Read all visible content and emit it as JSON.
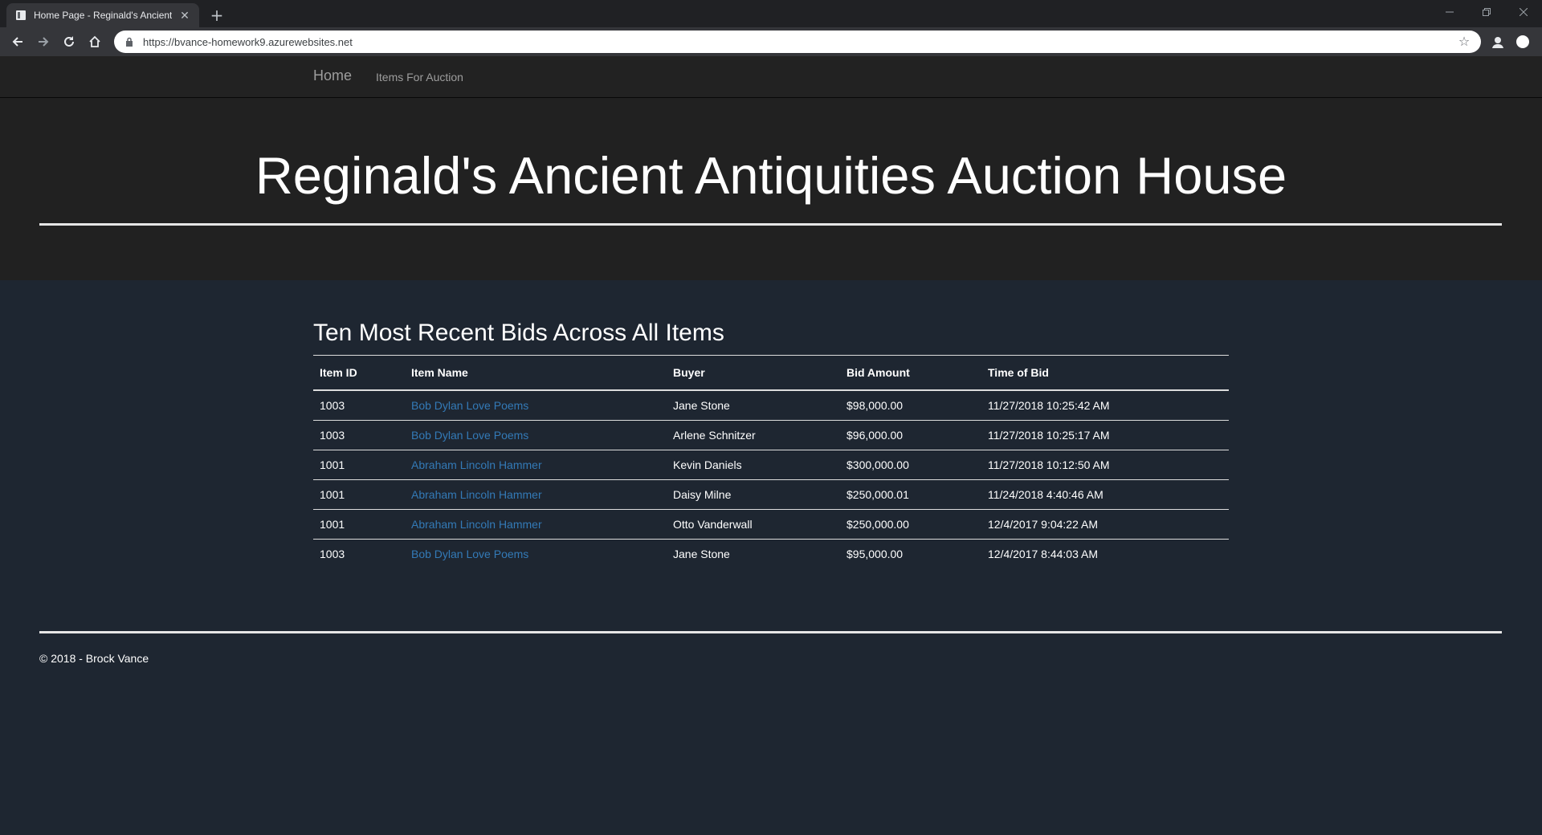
{
  "browser": {
    "tab_title": "Home Page - Reginald's Ancient",
    "url": "https://bvance-homework9.azurewebsites.net",
    "icons": {
      "back": "back-arrow-icon",
      "forward": "forward-arrow-icon",
      "reload": "reload-icon",
      "home": "home-icon",
      "lock": "lock-icon",
      "bookmark": "star-icon",
      "minimize": "minimize-icon",
      "restore": "restore-icon",
      "close": "close-icon"
    }
  },
  "navbar": {
    "brand": "Home",
    "links": [
      "Items For Auction"
    ]
  },
  "hero": {
    "title": "Reginald's Ancient Antiquities Auction House"
  },
  "main": {
    "heading": "Ten Most Recent Bids Across All Items",
    "columns": [
      "Item ID",
      "Item Name",
      "Buyer",
      "Bid Amount",
      "Time of Bid"
    ],
    "rows": [
      {
        "item_id": "1003",
        "item_name": "Bob Dylan Love Poems",
        "buyer": "Jane Stone",
        "bid_amount": "$98,000.00",
        "time": "11/27/2018 10:25:42 AM"
      },
      {
        "item_id": "1003",
        "item_name": "Bob Dylan Love Poems",
        "buyer": "Arlene Schnitzer",
        "bid_amount": "$96,000.00",
        "time": "11/27/2018 10:25:17 AM"
      },
      {
        "item_id": "1001",
        "item_name": "Abraham Lincoln Hammer",
        "buyer": "Kevin Daniels",
        "bid_amount": "$300,000.00",
        "time": "11/27/2018 10:12:50 AM"
      },
      {
        "item_id": "1001",
        "item_name": "Abraham Lincoln Hammer",
        "buyer": "Daisy Milne",
        "bid_amount": "$250,000.01",
        "time": "11/24/2018 4:40:46 AM"
      },
      {
        "item_id": "1001",
        "item_name": "Abraham Lincoln Hammer",
        "buyer": "Otto Vanderwall",
        "bid_amount": "$250,000.00",
        "time": "12/4/2017 9:04:22 AM"
      },
      {
        "item_id": "1003",
        "item_name": "Bob Dylan Love Poems",
        "buyer": "Jane Stone",
        "bid_amount": "$95,000.00",
        "time": "12/4/2017 8:44:03 AM"
      }
    ]
  },
  "footer": {
    "text": "© 2018 - Brock Vance"
  },
  "colors": {
    "page_bg": "#1e2631",
    "hero_bg": "#212121",
    "navbar_bg": "#222222",
    "link": "#337ab7",
    "nav_text": "#9d9d9d"
  }
}
